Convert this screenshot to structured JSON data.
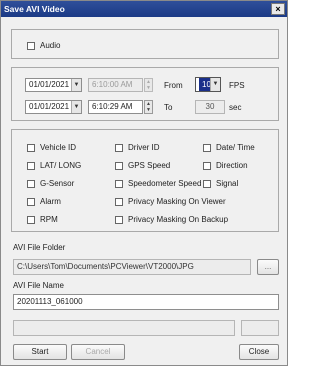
{
  "window": {
    "title": "Save AVI Video",
    "close_glyph": "×"
  },
  "audio": {
    "label": "Audio",
    "checked": false
  },
  "range": {
    "start_date": "01/01/2021",
    "start_time": "6:10:00 AM",
    "end_date": "01/01/2021",
    "end_time": "6:10:29 AM",
    "from_label": "From",
    "to_label": "To",
    "fps_value": "10",
    "fps_unit": "FPS",
    "duration_value": "30",
    "duration_unit": "sec"
  },
  "overlay_options": [
    {
      "label": "Vehicle ID",
      "checked": false
    },
    {
      "label": "Driver ID",
      "checked": false
    },
    {
      "label": "Date/ Time",
      "checked": false
    },
    {
      "label": "LAT/ LONG",
      "checked": false
    },
    {
      "label": "GPS Speed",
      "checked": false
    },
    {
      "label": "Direction",
      "checked": false
    },
    {
      "label": "G-Sensor",
      "checked": false
    },
    {
      "label": "Speedometer Speed",
      "checked": false
    },
    {
      "label": "Signal",
      "checked": false
    },
    {
      "label": "Alarm",
      "checked": false
    },
    {
      "label": "Privacy Masking On Viewer",
      "checked": false
    },
    {
      "label": "RPM",
      "checked": false
    },
    {
      "label": "Privacy Masking On Backup",
      "checked": false
    }
  ],
  "folder": {
    "label": "AVI File Folder",
    "path": "C:\\Users\\Tom\\Documents\\PCViewer\\VT2000\\JPG",
    "browse_label": "..."
  },
  "filename": {
    "label": "AVI File Name",
    "value": "20201113_061000"
  },
  "buttons": {
    "start": "Start",
    "cancel": "Cancel",
    "close": "Close"
  },
  "colors": {
    "title_bar": "#1b3a86",
    "fps_select": "#1a2f8a"
  }
}
